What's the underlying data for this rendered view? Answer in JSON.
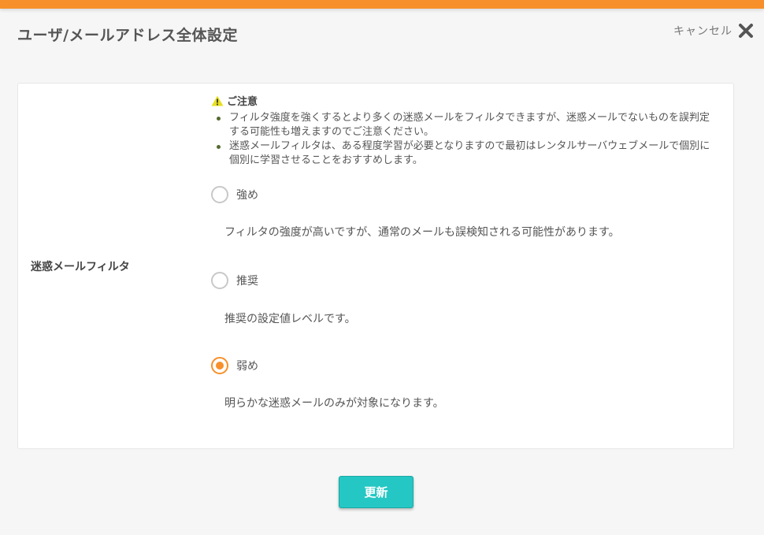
{
  "header": {
    "title": "ユーザ/メールアドレス全体設定",
    "cancel_label": "キャンセル",
    "accent_color": "#f7902a"
  },
  "filter": {
    "row_label": "迷惑メールフィルタ",
    "notice": {
      "title": "ご注意",
      "items": [
        "フィルタ強度を強くするとより多くの迷惑メールをフィルタできますが、迷惑メールでないものを誤判定する可能性も増えますのでご注意ください。",
        "迷惑メールフィルタは、ある程度学習が必要となりますので最初はレンタルサーバウェブメールで個別に個別に学習させることをおすすめします。"
      ]
    },
    "options": [
      {
        "label": "強め",
        "description": "フィルタの強度が高いですが、通常のメールも誤検知される可能性があります。",
        "selected": false
      },
      {
        "label": "推奨",
        "description": "推奨の設定値レベルです。",
        "selected": false
      },
      {
        "label": "弱め",
        "description": "明らかな迷惑メールのみが対象になります。",
        "selected": true
      }
    ]
  },
  "actions": {
    "update_label": "更新",
    "button_color": "#24c7c3"
  }
}
